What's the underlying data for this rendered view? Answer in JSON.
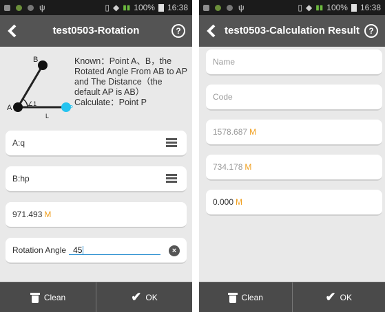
{
  "status_bar": {
    "battery": "100%",
    "time": "16:38"
  },
  "left_screen": {
    "title": "test0503-Rotation",
    "help": "?",
    "description": "Known：Point A、B，the Rotated Angle From AB to AP and The Distance（the default AP is AB）\nCalculate：Point P",
    "diagram": {
      "point_b": "B",
      "point_a": "A",
      "point_p": "P",
      "angle": "∠1",
      "line": "L"
    },
    "fields": [
      {
        "value": "A:q"
      },
      {
        "value": "B:hp"
      },
      {
        "value": "971.493",
        "unit": "M"
      },
      {
        "label": "Rotation Angle",
        "value": "45"
      }
    ],
    "clear_symbol": "×",
    "buttons": {
      "clean": "Clean",
      "ok": "OK"
    }
  },
  "right_screen": {
    "title": "test0503-Calculation Result",
    "help": "?",
    "fields": [
      {
        "placeholder": "Name"
      },
      {
        "placeholder": "Code"
      },
      {
        "value": "1578.687",
        "unit": "M"
      },
      {
        "value": "734.178",
        "unit": "M"
      },
      {
        "value": "0.000",
        "unit": "M"
      }
    ],
    "buttons": {
      "clean": "Clean",
      "ok": "OK"
    }
  },
  "colors": {
    "accent_blue": "#2a8fd0",
    "unit_orange": "#f0a020",
    "point_p_cyan": "#25c4f0",
    "title_bar": "#545454"
  }
}
